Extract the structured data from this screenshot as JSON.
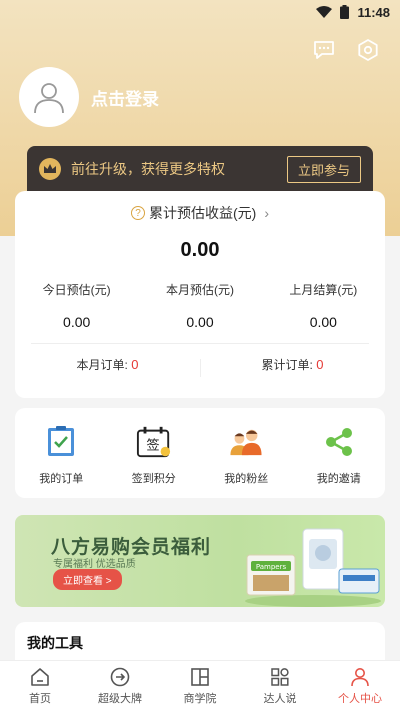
{
  "status_bar": {
    "time": "11:48"
  },
  "header": {
    "message_icon": "chat-icon",
    "settings_icon": "gear-icon",
    "login_label": "点击登录"
  },
  "vip": {
    "text": "前往升级，获得更多特权",
    "join_label": "立即参与"
  },
  "earnings": {
    "title": "累计预估收益(元)",
    "total": "0.00",
    "stats": [
      {
        "label": "今日预估(元)",
        "value": "0.00"
      },
      {
        "label": "本月预估(元)",
        "value": "0.00"
      },
      {
        "label": "上月结算(元)",
        "value": "0.00"
      }
    ],
    "orders": [
      {
        "label": "本月订单:",
        "value": "0"
      },
      {
        "label": "累计订单:",
        "value": "0"
      }
    ]
  },
  "menu": [
    {
      "label": "我的订单",
      "icon": "clipboard-icon"
    },
    {
      "label": "签到积分",
      "icon": "calendar-sign-icon"
    },
    {
      "label": "我的粉丝",
      "icon": "fans-icon"
    },
    {
      "label": "我的邀请",
      "icon": "share-icon"
    }
  ],
  "banner": {
    "title": "八方易购会员福利",
    "subtitle": "专属福利 优选品质",
    "button": "立即查看 >",
    "product_label": "Pampers"
  },
  "tools": {
    "title": "我的工具"
  },
  "tabbar": [
    {
      "label": "首页",
      "icon": "home-icon",
      "active": false
    },
    {
      "label": "超级大牌",
      "icon": "arrow-circle-icon",
      "active": false
    },
    {
      "label": "商学院",
      "icon": "school-icon",
      "active": false
    },
    {
      "label": "达人说",
      "icon": "grid-icon",
      "active": false
    },
    {
      "label": "个人中心",
      "icon": "person-icon",
      "active": true
    }
  ],
  "colors": {
    "accent": "#e65347",
    "gold": "#ecc884",
    "header": "#eccf95"
  }
}
